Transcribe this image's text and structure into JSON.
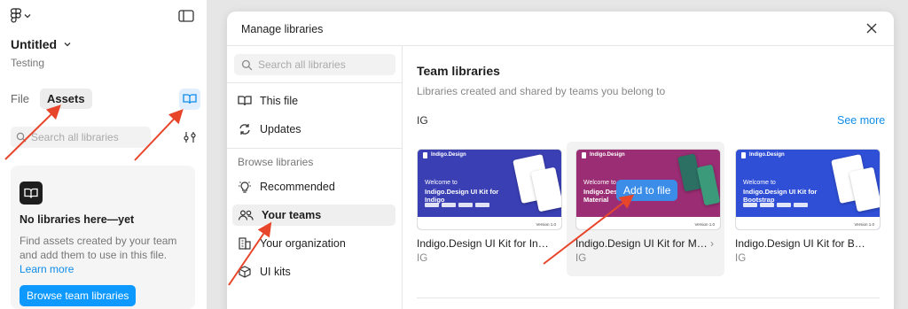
{
  "app": {
    "file_title": "Untitled",
    "file_subtitle": "Testing"
  },
  "left_panel": {
    "tabs": [
      {
        "label": "File",
        "active": false
      },
      {
        "label": "Assets",
        "active": true
      }
    ],
    "search_placeholder": "Search all libraries",
    "empty_state": {
      "title": "No libraries here—yet",
      "text": "Find assets created by your team and add them to use in this file.",
      "link": "Learn more",
      "button": "Browse team libraries"
    }
  },
  "modal": {
    "title": "Manage libraries",
    "search_placeholder": "Search all libraries",
    "nav_items": [
      {
        "label": "This file",
        "icon": "book-open-icon"
      },
      {
        "label": "Updates",
        "icon": "refresh-icon"
      }
    ],
    "browse_section_label": "Browse libraries",
    "browse_items": [
      {
        "label": "Recommended",
        "icon": "lightbulb-icon",
        "selected": false
      },
      {
        "label": "Your teams",
        "icon": "people-icon",
        "selected": true
      },
      {
        "label": "Your organization",
        "icon": "building-icon",
        "selected": false
      },
      {
        "label": "UI kits",
        "icon": "package-icon",
        "selected": false
      }
    ],
    "main": {
      "title": "Team libraries",
      "subtitle": "Libraries created and shared by teams you belong to",
      "team_name": "IG",
      "see_more": "See more",
      "add_to_file": "Add to file",
      "cards": [
        {
          "name": "Indigo.Design UI Kit for Indigo",
          "team": "IG",
          "thumb_brand": "Indigo.Design",
          "thumb_welcome": "Welcome to",
          "thumb_title": "Indigo.Design UI Kit for Indigo",
          "thumb_color": "#3a3fb4",
          "version": "Version 1.0"
        },
        {
          "name": "Indigo.Design UI Kit for Material",
          "team": "IG",
          "thumb_brand": "Indigo.Design",
          "thumb_welcome": "Welcome to",
          "thumb_title": "Indigo.Design UI Kit for Material",
          "thumb_color": "#9a2d73",
          "version": "Version 1.0"
        },
        {
          "name": "Indigo.Design UI Kit for Bootstrap",
          "team": "IG",
          "thumb_brand": "Indigo.Design",
          "thumb_welcome": "Welcome to",
          "thumb_title": "Indigo.Design UI Kit for Bootstrap",
          "thumb_color": "#2f4fd6",
          "version": "Version 1.0"
        }
      ]
    }
  },
  "colors": {
    "accent_blue": "#0d99ff",
    "link_blue": "#0d8ce9",
    "annotation_arrow": "#e8462a"
  }
}
